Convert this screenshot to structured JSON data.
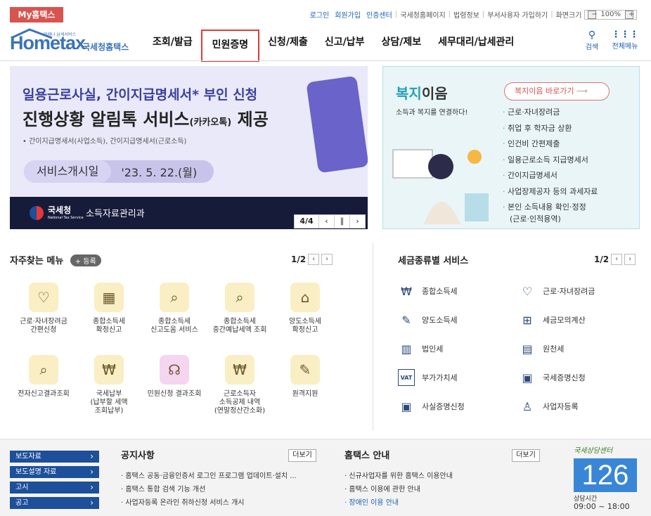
{
  "top": {
    "my_label": "My홈택스",
    "links": [
      "로그인",
      "회원가입",
      "인증센터",
      "국세청홈페이지",
      "법령정보",
      "부서사용자 가입하기",
      "화면크기"
    ],
    "zoom": "100%"
  },
  "logo": {
    "brand": "Hometax",
    "sub": "국세청홈택스",
    "tagline": "언제나 납세서비스"
  },
  "gnb": [
    "조회/발급",
    "민원증명",
    "신청/제출",
    "신고/납부",
    "상담/제보",
    "세무대리/납세관리"
  ],
  "util": {
    "search": "검색",
    "all_menu": "전체메뉴"
  },
  "banner": {
    "line1": "일용근로사실, 간이지급명세서* 부인 신청",
    "line1_star": "*",
    "line2_a": "진행상황 알림톡 서비스",
    "line2_b": "(카카오톡)",
    "line2_c": "제공",
    "note": "• 간이지급명세서(사업소득), 간이지급명세서(근로소득)",
    "pill_a": "서비스개시일",
    "pill_b": "'23. 5. 22.(월)",
    "footer_org": "국세청",
    "footer_org_en": "National Tax Service",
    "footer_dept": "소득자료관리과",
    "pager": "4/4"
  },
  "welfare": {
    "title_a": "복지",
    "title_b": "이음",
    "desc": "소득과 복지를 연결하다!",
    "button": "복지이음 바로가기",
    "items": [
      "근로·자녀장려금",
      "취업 후 학자금 상환",
      "인건비 간편제출",
      "일용근로소득 지급명세서",
      "간이지급명세서",
      "사업장제공자 등의 과세자료",
      "본인 소득내용 확인·정정",
      "(근로·인적용역)"
    ]
  },
  "fav": {
    "title": "자주찾는 메뉴",
    "register": "+ 등록",
    "page": "1/2",
    "items": [
      {
        "label": "근로·자녀장려금\n간편신청",
        "icon": "heart-hands-icon"
      },
      {
        "label": "종합소득세\n확정신고",
        "icon": "calendar-icon"
      },
      {
        "label": "종합소득세\n신고도움 서비스",
        "icon": "doc-search-icon"
      },
      {
        "label": "종합소득세\n중간예납세액 조회",
        "icon": "doc-search-icon"
      },
      {
        "label": "양도소득세\n확정신고",
        "icon": "house-icon"
      },
      {
        "label": "전자신고결과조회",
        "icon": "doc-search-icon"
      },
      {
        "label": "국세납부\n(납부할 세액\n조회납부)",
        "icon": "money-bag-icon"
      },
      {
        "label": "민원신청 결과조회",
        "icon": "headset-icon"
      },
      {
        "label": "근로소득자\n소득공제 내역\n(연말정산간소화)",
        "icon": "money-bag-icon"
      },
      {
        "label": "원격지원",
        "icon": "person-edit-icon"
      }
    ]
  },
  "tax": {
    "title": "세금종류별 서비스",
    "page": "1/2",
    "items": [
      {
        "label": "종합소득세",
        "icon": "money-bag-icon"
      },
      {
        "label": "근로·자녀장려금",
        "icon": "heart-icon"
      },
      {
        "label": "양도소득세",
        "icon": "doc-edit-icon"
      },
      {
        "label": "세금모의계산",
        "icon": "calculator-icon"
      },
      {
        "label": "법인세",
        "icon": "building-icon"
      },
      {
        "label": "원천세",
        "icon": "receipt-icon"
      },
      {
        "label": "부가가치세",
        "icon": "vat-icon"
      },
      {
        "label": "국세증명신청",
        "icon": "certificate-icon"
      },
      {
        "label": "사실증명신청",
        "icon": "certificate-icon"
      },
      {
        "label": "사업자등록",
        "icon": "person-icon"
      }
    ]
  },
  "bottom": {
    "links": [
      "보도자료",
      "보도설명 자료",
      "고시",
      "공고"
    ],
    "notice_title": "공지사항",
    "notice_more": "더보기",
    "notices": [
      "홈택스 공동·금융인증서 로그인 프로그램 업데이트·설치 ...",
      "홈택스 통합 검색 기능 개선",
      "사업자등록 온라인 취하신청 서비스 개시"
    ],
    "guide_title": "홈택스 안내",
    "guide_more": "더보기",
    "guides": [
      "신규사업자를 위한 홈택스 이용안내",
      "홈택스 이용에 관한 안내",
      "장애인 이용 안내"
    ],
    "call_label": "국세상담센터",
    "call_num": "126",
    "call_time_label": "상담시간",
    "call_time": "09:00 ~ 18:00"
  },
  "colors": {
    "accent": "#1a5fb4",
    "red": "#d9534f",
    "navy": "#1d4f9a"
  }
}
